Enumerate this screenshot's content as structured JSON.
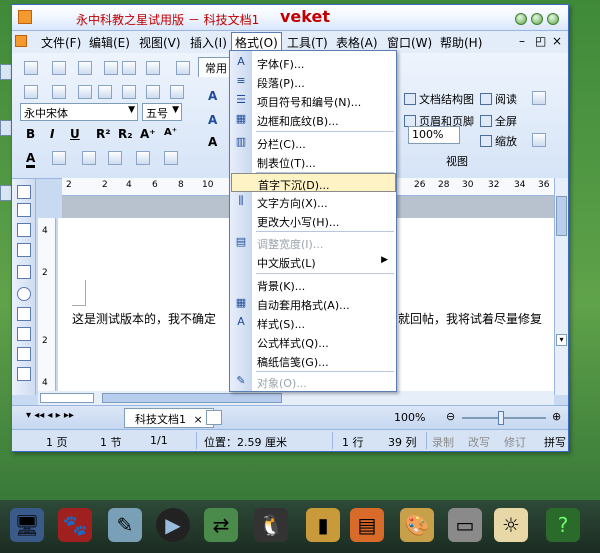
{
  "window": {
    "title": "永中科教之星试用版 － 科技文档1",
    "watermark": "veket"
  },
  "menubar": {
    "items": [
      "文件(F)",
      "编辑(E)",
      "视图(V)",
      "插入(I)",
      "格式(O)",
      "工具(T)",
      "表格(A)",
      "窗口(W)",
      "帮助(H)"
    ]
  },
  "toolbar": {
    "normal_tab": "常用",
    "font_name": "永中宋体",
    "font_size": "五号",
    "bold": "B",
    "italic": "I",
    "underline": "U",
    "superscript": "R²",
    "subscript": "R₂",
    "grow_font": "A⁺",
    "shrink_font": "A⁺",
    "zoom_combo": "100%",
    "view_items": [
      "文档结构图",
      "阅读",
      "页眉和页脚",
      "全屏",
      "缩放"
    ],
    "view_group_label": "视图"
  },
  "format_menu": {
    "items": [
      {
        "label": "字体(F)...",
        "icon": "A"
      },
      {
        "label": "段落(P)...",
        "icon": "≡"
      },
      {
        "label": "项目符号和编号(N)...",
        "icon": "☰"
      },
      {
        "label": "边框和底纹(B)...",
        "icon": "▦"
      },
      {
        "label": "分栏(C)...",
        "icon": "▥"
      },
      {
        "label": "制表位(T)...",
        "icon": ""
      },
      {
        "label": "首字下沉(D)...",
        "icon": ""
      },
      {
        "label": "文字方向(X)...",
        "icon": "⫼"
      },
      {
        "label": "更改大小写(H)...",
        "icon": ""
      },
      {
        "label": "调整宽度(I)...",
        "icon": "▤"
      },
      {
        "label": "中文版式(L)",
        "icon": ""
      },
      {
        "label": "背景(K)...",
        "icon": ""
      },
      {
        "label": "自动套用格式(A)...",
        "icon": "▦"
      },
      {
        "label": "样式(S)...",
        "icon": "A"
      },
      {
        "label": "公式样式(Q)...",
        "icon": ""
      },
      {
        "label": "稿纸信笺(G)...",
        "icon": ""
      },
      {
        "label": "对象(O)...",
        "icon": "✎"
      }
    ]
  },
  "ruler": {
    "ticks": [
      "2",
      "2",
      "4",
      "6",
      "8",
      "10",
      "26",
      "28",
      "30",
      "32",
      "34",
      "36"
    ],
    "vticks": [
      "4",
      "2",
      "2",
      "4"
    ]
  },
  "document": {
    "text_left": "这是测试版本的，我不确定",
    "text_right": "就回帖，我将试着尽量修复"
  },
  "doc_tabs": {
    "active": "科技文档1",
    "zoom": "100%"
  },
  "statusbar": {
    "page": "1 页",
    "section": "1 节",
    "page_of": "1/1",
    "position": "位置：2.59 厘米",
    "line": "1 行",
    "column": "39 列",
    "record": "录制",
    "revise": "改写",
    "track": "修订",
    "spell": "拼写"
  },
  "colors": {
    "accent": "#3a6bc6",
    "menu_highlight": "#fdf3c4",
    "title_red": "#c00000",
    "desktop_green": "#4f9a43"
  }
}
